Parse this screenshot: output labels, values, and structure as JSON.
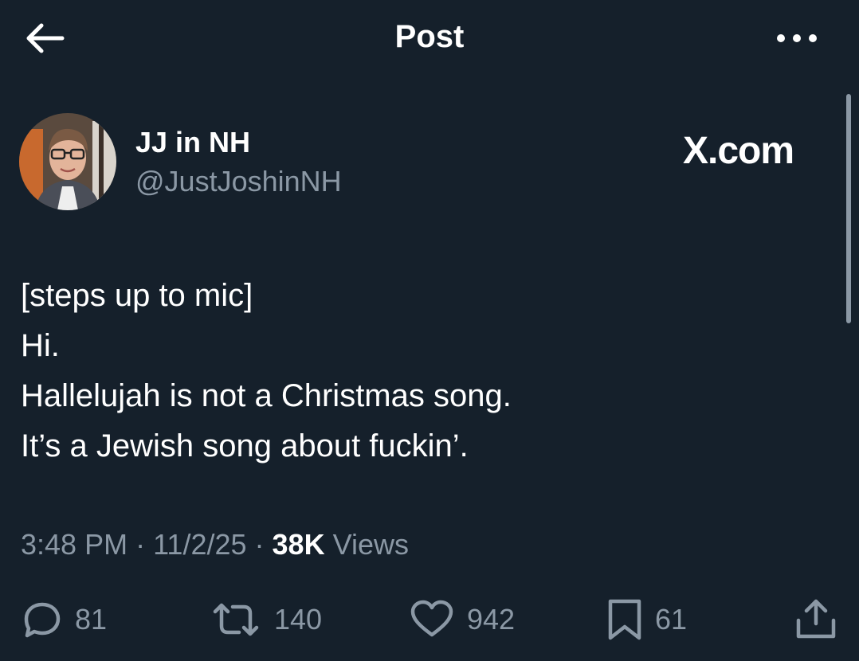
{
  "header": {
    "title": "Post",
    "back_icon": "arrow-left-icon",
    "more_icon": "more-horizontal-icon"
  },
  "author": {
    "display_name": "JJ in NH",
    "handle": "@JustJoshinNH",
    "avatar_icon": "profile-photo"
  },
  "watermark": "X.com",
  "tweet": {
    "lines": [
      "[steps up to mic]",
      "Hi.",
      "Hallelujah is not a Christmas song.",
      "It’s a Jewish song about fuckin’."
    ]
  },
  "meta": {
    "time": "3:48 PM",
    "sep1": " · ",
    "date": "11/2/25",
    "sep2": " · ",
    "views_count": "38K",
    "views_label": " Views"
  },
  "actions": {
    "replies": "81",
    "reposts": "140",
    "likes": "942",
    "bookmarks": "61"
  },
  "colors": {
    "background": "#15202b",
    "text": "#ffffff",
    "secondary": "#8b98a5"
  }
}
